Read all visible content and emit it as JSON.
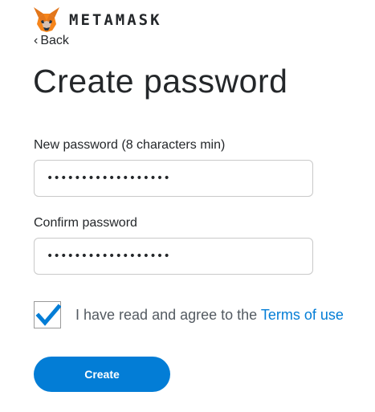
{
  "brand": {
    "name": "METAMASK",
    "logo_icon": "metamask-fox-icon"
  },
  "nav": {
    "back_label": "Back",
    "back_icon": "chevron-left-icon"
  },
  "page_title": "Create password",
  "form": {
    "new_password_label": "New password (8 characters min)",
    "new_password_value": "••••••••••••••••••",
    "confirm_password_label": "Confirm password",
    "confirm_password_value": "••••••••••••••••••",
    "agree_text": "I have read and agree to the ",
    "terms_link": "Terms of use",
    "agree_checked": true,
    "submit_label": "Create"
  },
  "colors": {
    "accent": "#037dd6",
    "text": "#24272a",
    "muted_text": "#535a61",
    "border": "#c9c9c9"
  }
}
